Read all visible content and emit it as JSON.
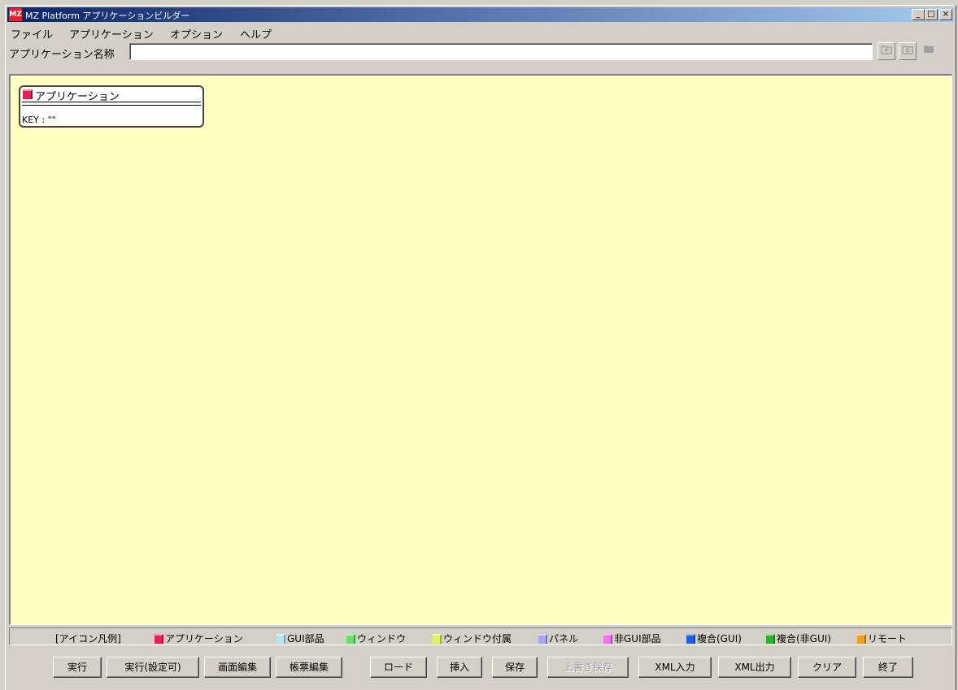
{
  "window": {
    "title": "MZ Platform アプリケーションビルダー",
    "icon_text": "MZ",
    "controls": {
      "minimize": "_",
      "maximize": "□",
      "close": "×"
    }
  },
  "menu": [
    "ファイル",
    "アプリケーション",
    "オプション",
    "ヘルプ"
  ],
  "name_bar": {
    "label": "アプリケーション名称",
    "value": "",
    "toolbar_icons": [
      "folder-up-icon",
      "folder-gear-icon",
      "folder-icon"
    ]
  },
  "canvas": {
    "background": "#ffffc0",
    "node": {
      "title": "アプリケーション",
      "key": "KEY : \"\"",
      "color": "#e8205a"
    }
  },
  "legend": {
    "title": "[アイコン凡例]",
    "items": [
      {
        "label": "アプリケーション",
        "color": "#e8205a"
      },
      {
        "label": "GUI部品",
        "color": "#b8e4f0"
      },
      {
        "label": "ウィンドウ",
        "color": "#66e066"
      },
      {
        "label": "ウィンドウ付属",
        "color": "#e0f060"
      },
      {
        "label": "パネル",
        "color": "#a8a8f0"
      },
      {
        "label": "非GUI部品",
        "color": "#f070f0"
      },
      {
        "label": "複合(GUI)",
        "color": "#2060e0"
      },
      {
        "label": "複合(非GUI)",
        "color": "#30b030"
      },
      {
        "label": "リモート",
        "color": "#f0a020"
      }
    ]
  },
  "buttons": {
    "run": "実行",
    "run_config": "実行(設定可)",
    "screen_edit": "画面編集",
    "form_edit": "帳票編集",
    "load": "ロード",
    "insert": "挿入",
    "save": "保存",
    "overwrite": "上書き保存",
    "xml_in": "XML入力",
    "xml_out": "XML出力",
    "clear": "クリア",
    "exit": "終了"
  }
}
